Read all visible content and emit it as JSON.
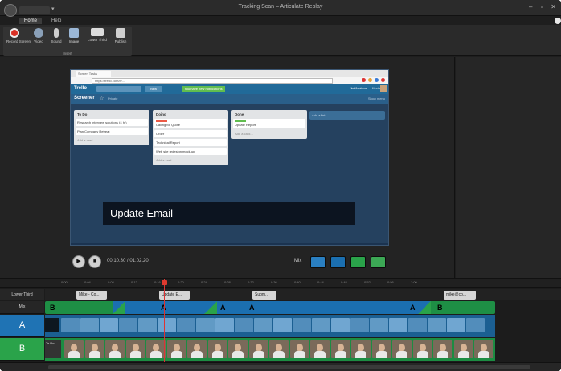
{
  "window": {
    "title": "Tracking Scan – Articulate Replay",
    "controls": [
      "–",
      "▫",
      "✕"
    ]
  },
  "ribbon": {
    "tabs": [
      {
        "label": "Home"
      },
      {
        "label": "Help"
      }
    ],
    "buttons": [
      {
        "label": "Record Screen",
        "icon": "record-icon",
        "color": "#d93025"
      },
      {
        "label": "Video",
        "icon": "webcam-icon",
        "color": "#8aa0b8"
      },
      {
        "label": "Sound",
        "icon": "microphone-icon",
        "color": "#cfcfcf"
      },
      {
        "label": "Image",
        "icon": "image-icon",
        "color": "#9bb7d6"
      },
      {
        "label": "Lower Third",
        "icon": "lower-third-icon",
        "color": "#dcdcdc"
      },
      {
        "label": "Publish",
        "icon": "publish-icon",
        "color": "#cfcfcf"
      }
    ],
    "group_label": "Insert"
  },
  "preview": {
    "browser_tab": "Screen Tasks",
    "url": "https://trello.com/b/...",
    "trello": {
      "logo": "Trello",
      "new_button": "New",
      "notice": "You have new notifications",
      "user": "Notifications",
      "name": "Kevin",
      "board_title": "Screener",
      "board_private": "Private",
      "board_menu": "Show menu"
    },
    "lists": [
      {
        "title": "To Do",
        "cards": [
          "Research interview solutions (4 hr)",
          "Plan Company Retreat"
        ],
        "add": "Add a card..."
      },
      {
        "title": "Doing",
        "cards": [
          "Calling for Quote",
          "Order",
          "Technical Report",
          "Web site redesign mock-up"
        ],
        "add": "Add a card..."
      },
      {
        "title": "Done",
        "cards": [
          "Update Report"
        ],
        "add": "Add a card..."
      }
    ],
    "add_list": "Add a list...",
    "caption": "Update Email"
  },
  "playback": {
    "play_icon": "▶",
    "stop_icon": "■",
    "timecode": "00:10.30 / 01:02.20",
    "mix_label": "Mix"
  },
  "mix_buttons": [
    {
      "icon": "mix-ab-icon",
      "color": "#2a7fc1"
    },
    {
      "icon": "mix-a-icon",
      "color": "#1b6fb0"
    },
    {
      "icon": "mix-b-icon",
      "color": "#2aa34a"
    },
    {
      "icon": "mix-pip-icon",
      "color": "#3ca855"
    }
  ],
  "timeline": {
    "ruler_ticks": [
      "0:00",
      "0:04",
      "0:08",
      "0:12",
      "0:16",
      "0:20",
      "0:24",
      "0:28",
      "0:32",
      "0:36",
      "0:40",
      "0:44",
      "0:48",
      "0:52",
      "0:56",
      "1:00"
    ],
    "tracks": {
      "lower_third": "Lower Third",
      "mix": "Mix",
      "a": "A",
      "b": "B"
    },
    "lower_third_clips": [
      {
        "label": "Mike - Co..."
      },
      {
        "label": "Update E..."
      },
      {
        "label": "Subm..."
      },
      {
        "label": "mike@co..."
      }
    ],
    "mix_segments": [
      "B",
      "A",
      "A",
      "A",
      "A",
      "A",
      "B"
    ],
    "b_first_label": "To Do"
  }
}
